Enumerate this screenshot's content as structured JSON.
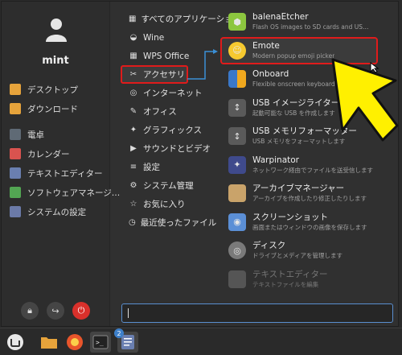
{
  "user": {
    "name": "mint"
  },
  "favorites": [
    {
      "label": "デスクトップ",
      "icon": "folder-icon",
      "color": "#e6a33b"
    },
    {
      "label": "ダウンロード",
      "icon": "download-folder-icon",
      "color": "#e6a33b"
    },
    {
      "label": "電卓",
      "icon": "calculator-icon",
      "color": "#5f6a75"
    },
    {
      "label": "カレンダー",
      "icon": "calendar-icon",
      "color": "#d9534f"
    },
    {
      "label": "テキストエディター",
      "icon": "text-editor-icon",
      "color": "#6a7fb0"
    },
    {
      "label": "ソフトウェアマネージ…",
      "icon": "software-manager-icon",
      "color": "#53a653"
    },
    {
      "label": "システムの設定",
      "icon": "settings-icon",
      "color": "#6b7aa8"
    }
  ],
  "categories": [
    {
      "label": "すべてのアプリケーション",
      "icon": "grid-icon"
    },
    {
      "label": "Wine",
      "icon": "wine-icon"
    },
    {
      "label": "WPS Office",
      "icon": "wps-icon"
    },
    {
      "label": "アクセサリ",
      "icon": "accessories-icon"
    },
    {
      "label": "インターネット",
      "icon": "internet-icon"
    },
    {
      "label": "オフィス",
      "icon": "office-icon"
    },
    {
      "label": "グラフィックス",
      "icon": "graphics-icon"
    },
    {
      "label": "サウンドとビデオ",
      "icon": "sound-video-icon"
    },
    {
      "label": "設定",
      "icon": "preferences-icon"
    },
    {
      "label": "システム管理",
      "icon": "admin-icon"
    },
    {
      "label": "お気に入り",
      "icon": "star-icon"
    },
    {
      "label": "最近使ったファイル",
      "icon": "recent-icon"
    }
  ],
  "apps": [
    {
      "name": "balenaEtcher",
      "desc": "Flash OS images to SD cards and US…",
      "icon": "etcher-icon",
      "color": "#8cc63f"
    },
    {
      "name": "Emote",
      "desc": "Modern popup emoji picker",
      "icon": "emote-icon",
      "color": "#f6c92f"
    },
    {
      "name": "Onboard",
      "desc": "Flexible onscreen keyboard",
      "icon": "onboard-icon",
      "color": "#f0a81e"
    },
    {
      "name": "USB イメージライター",
      "desc": "起動可能な USB を作成します",
      "icon": "usb-writer-icon",
      "color": "#888888"
    },
    {
      "name": "USB メモリフォーマッター",
      "desc": "USB メモリをフォーマットします",
      "icon": "usb-format-icon",
      "color": "#888888"
    },
    {
      "name": "Warpinator",
      "desc": "ネットワーク経由でファイルを送受信します",
      "icon": "warpinator-icon",
      "color": "#3f4a8c"
    },
    {
      "name": "アーカイブマネージャー",
      "desc": "アーカイブを作成したり修正したりします",
      "icon": "archive-icon",
      "color": "#c9a36a"
    },
    {
      "name": "スクリーンショット",
      "desc": "画面またはウィンドウの画像を保存します",
      "icon": "screenshot-icon",
      "color": "#5b8fd6"
    },
    {
      "name": "ディスク",
      "desc": "ドライブとメディアを管理します",
      "icon": "disks-icon",
      "color": "#7a7a7a"
    },
    {
      "name": "テキストエディター",
      "desc": "テキストファイルを編集",
      "icon": "text-editor-icon",
      "color": "#555555"
    }
  ],
  "search": {
    "placeholder": "",
    "value": ""
  },
  "taskbar": {
    "badge_count": "2"
  }
}
